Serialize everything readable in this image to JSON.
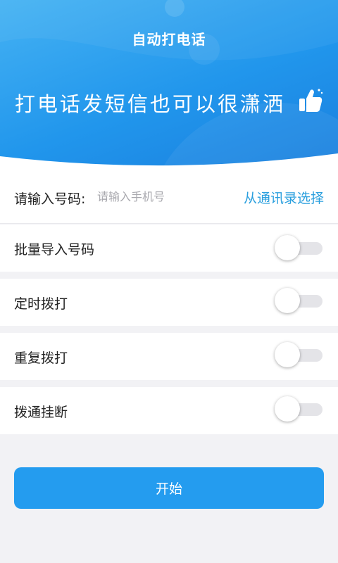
{
  "header": {
    "title": "自动打电话",
    "banner": "打电话发短信也可以很潇洒"
  },
  "phone": {
    "label": "请输入号码:",
    "placeholder": "请输入手机号",
    "value": "",
    "contacts_link": "从通讯录选择"
  },
  "options": [
    {
      "label": "批量导入号码",
      "enabled": false
    },
    {
      "label": "定时拨打",
      "enabled": false
    },
    {
      "label": "重复拨打",
      "enabled": false
    },
    {
      "label": "拨通挂断",
      "enabled": false
    }
  ],
  "start_button": {
    "label": "开始"
  },
  "colors": {
    "accent": "#249cef",
    "link": "#2a9fde",
    "header_gradient_start": "#45b2f3",
    "header_gradient_end": "#1a7fde",
    "background": "#f2f2f5"
  },
  "icons": {
    "banner_icon": "thumbs-up-icon"
  }
}
